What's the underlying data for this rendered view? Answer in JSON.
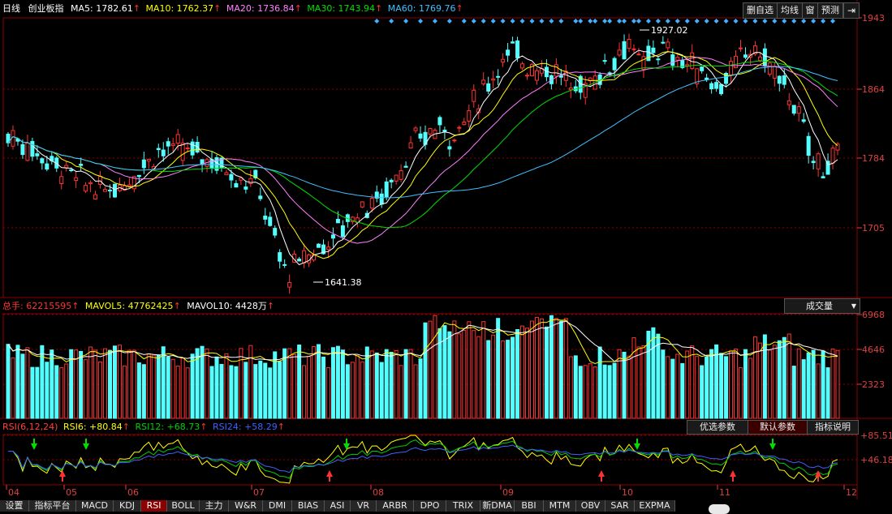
{
  "main": {
    "period": "日线",
    "index_name": "创业板指",
    "ma": [
      {
        "label": "MA5",
        "value": "1782.61",
        "color": "#ffffff"
      },
      {
        "label": "MA10",
        "value": "1762.37",
        "color": "#ffff00"
      },
      {
        "label": "MA20",
        "value": "1736.84",
        "color": "#ff80ff"
      },
      {
        "label": "MA30",
        "value": "1743.94",
        "color": "#00e000"
      },
      {
        "label": "MA60",
        "value": "1769.76",
        "color": "#40c0ff"
      }
    ],
    "buttons": [
      "删自选",
      "均线",
      "窗",
      "预测"
    ],
    "price_ticks": [
      "1943",
      "1864",
      "1784",
      "1705"
    ],
    "high_label": "1927.02",
    "low_label": "1641.38"
  },
  "volume": {
    "total_label": "总手",
    "total_value": "62215595",
    "mavol5_label": "MAVOL5",
    "mavol5_value": "47762425",
    "mavol10_label": "MAVOL10",
    "mavol10_value": "4428万",
    "selector": "成交量",
    "ticks": [
      "6968",
      "4646",
      "2323"
    ]
  },
  "rsi": {
    "title": "RSI(6,12,24)",
    "rsi6_label": "RSI6",
    "rsi6_value": "+80.84",
    "rsi12_label": "RSI12",
    "rsi12_value": "+68.73",
    "rsi24_label": "RSI24",
    "rsi24_value": "+58.29",
    "buttons": [
      "优选参数",
      "默认参数",
      "指标说明"
    ],
    "ticks": [
      "+85.51",
      "+46.18"
    ]
  },
  "x_axis": [
    "04",
    "05",
    "06",
    "07",
    "08",
    "09",
    "10",
    "11",
    "12"
  ],
  "tabs": [
    "设置",
    "指标平台",
    "MACD",
    "KDJ",
    "RSI",
    "BOLL",
    "主力",
    "W&R",
    "DMI",
    "BIAS",
    "ASI",
    "VR",
    "ARBR",
    "DPO",
    "TRIX",
    "新DMA",
    "BBI",
    "MTM",
    "OBV",
    "SAR",
    "EXPMA"
  ],
  "active_tab": "RSI",
  "colors": {
    "up": "#ff3232",
    "down": "#54ffff",
    "grid": "#8b0000",
    "axis_text": "#e04040",
    "diamond": "#40b0ff"
  }
}
